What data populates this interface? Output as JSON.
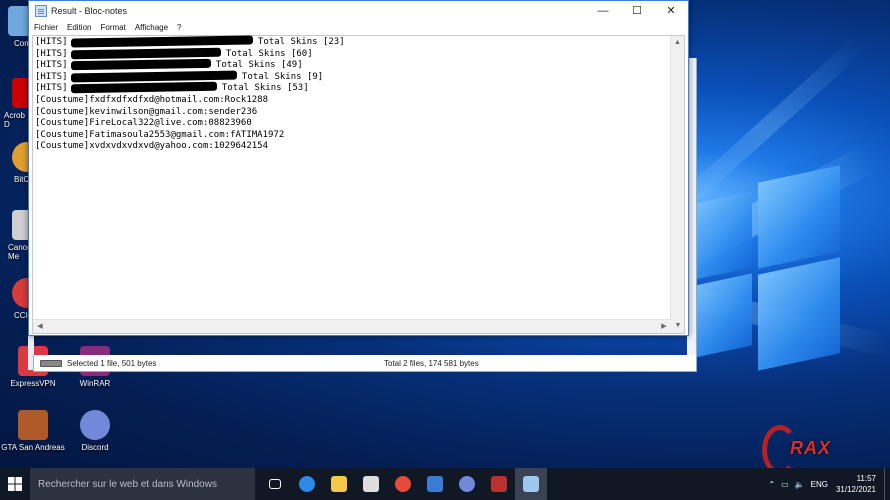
{
  "window": {
    "title": "Result - Bloc-notes",
    "minimize": "—",
    "maximize": "☐",
    "close": "✕"
  },
  "menu": [
    "Fichier",
    "Edition",
    "Format",
    "Affichage",
    "?"
  ],
  "lines": [
    {
      "prefix": "[HITS]",
      "redact_width": 182,
      "suffix": " Total Skins [23]"
    },
    {
      "prefix": "[HITS]",
      "redact_width": 150,
      "suffix": " Total Skins [60]"
    },
    {
      "prefix": "[HITS]",
      "redact_width": 140,
      "suffix": " Total Skins [49]"
    },
    {
      "prefix": "[HITS]",
      "redact_width": 166,
      "suffix": " Total Skins [9]"
    },
    {
      "prefix": "[HITS]",
      "redact_width": 146,
      "suffix": " Total Skins [53]"
    },
    {
      "prefix": "[Coustume]",
      "text": "fxdfxdfxdfxd@hotmail.com:Rock1288"
    },
    {
      "prefix": "[Coustume]",
      "text": "kevinwilson@gmail.com:sender236"
    },
    {
      "prefix": "[Coustume]",
      "text": "FireLocal322@live.com:08823960"
    },
    {
      "prefix": "[Coustume]",
      "text": "Fatimasoula2553@gmail.com:fATIMA1972"
    },
    {
      "prefix": "[Coustume]",
      "text": "xvdxvdxvdxvd@yahoo.com:1029642154"
    }
  ],
  "explorer": {
    "selected": "Selected 1 file, 501 bytes",
    "total": "Total 2 files, 174 581 bytes"
  },
  "desktop_icons": [
    {
      "label": "Com",
      "color": "#6fa8dc",
      "icon": "computer-icon"
    },
    {
      "label": "Acrob\nD",
      "color": "#cc0000",
      "icon": "acrobat-icon"
    },
    {
      "label": "BitC",
      "color": "#e0a030",
      "icon": "bitcomet-icon"
    },
    {
      "label": "Canor\nMe",
      "color": "#cfcfcf",
      "icon": "canon-icon"
    },
    {
      "label": "CCle",
      "color": "#d83b3b",
      "icon": "ccleaner-icon"
    },
    {
      "label": "ExpressVPN",
      "color": "#da3940",
      "icon": "expressvpn-icon"
    },
    {
      "label": "WinRAR",
      "color": "#8a2b7a",
      "icon": "winrar-icon"
    },
    {
      "label": "GTA San Andreas",
      "color": "#b05a2a",
      "icon": "gta-icon"
    },
    {
      "label": "Discord",
      "color": "#7289da",
      "icon": "discord-icon"
    }
  ],
  "taskbar": {
    "search_placeholder": "Rechercher sur le web et dans Windows",
    "apps": [
      {
        "icon": "task-view-icon",
        "color": "#ffffff"
      },
      {
        "icon": "edge-icon",
        "color": "#2d8ae6"
      },
      {
        "icon": "file-explorer-icon",
        "color": "#f2c84b"
      },
      {
        "icon": "store-icon",
        "color": "#dddddd"
      },
      {
        "icon": "chrome-icon",
        "color": "#e64a3b"
      },
      {
        "icon": "network-app-icon",
        "color": "#3a7bd5"
      },
      {
        "icon": "discord-icon",
        "color": "#7289da"
      },
      {
        "icon": "winrar-icon",
        "color": "#b8322f"
      },
      {
        "icon": "notepad-icon",
        "color": "#9fc7ee"
      }
    ],
    "lang": "ENG",
    "time": "11:57",
    "date": "31/12/2021"
  },
  "watermark": "RAX"
}
